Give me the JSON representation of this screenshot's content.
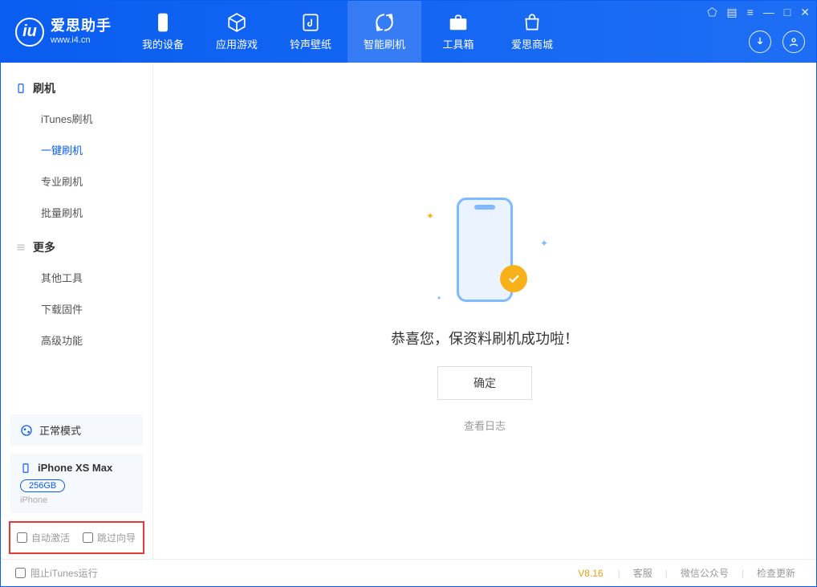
{
  "app": {
    "name": "爱思助手",
    "url": "www.i4.cn"
  },
  "tabs": {
    "device": "我的设备",
    "apps": "应用游戏",
    "ring": "铃声壁纸",
    "flash": "智能刷机",
    "tools": "工具箱",
    "store": "爱思商城"
  },
  "sidebar": {
    "group1": {
      "title": "刷机",
      "items": [
        "iTunes刷机",
        "一键刷机",
        "专业刷机",
        "批量刷机"
      ]
    },
    "group2": {
      "title": "更多",
      "items": [
        "其他工具",
        "下载固件",
        "高级功能"
      ]
    }
  },
  "mode": {
    "label": "正常模式"
  },
  "device": {
    "name": "iPhone XS Max",
    "capacity": "256GB",
    "type": "iPhone"
  },
  "checkboxes": {
    "auto_activate": "自动激活",
    "skip_guide": "跳过向导"
  },
  "main": {
    "message": "恭喜您，保资料刷机成功啦！",
    "ok": "确定",
    "view_log": "查看日志"
  },
  "footer": {
    "block_itunes": "阻止iTunes运行",
    "version": "V8.16",
    "support": "客服",
    "wechat": "微信公众号",
    "update": "检查更新"
  }
}
